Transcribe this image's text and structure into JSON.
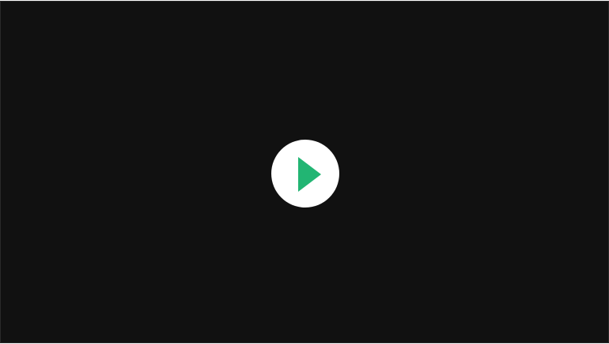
{
  "player": {
    "background_color": "#111111",
    "play_button": {
      "icon": "play-icon",
      "circle_color": "#ffffff",
      "icon_color": "#22b573"
    }
  }
}
